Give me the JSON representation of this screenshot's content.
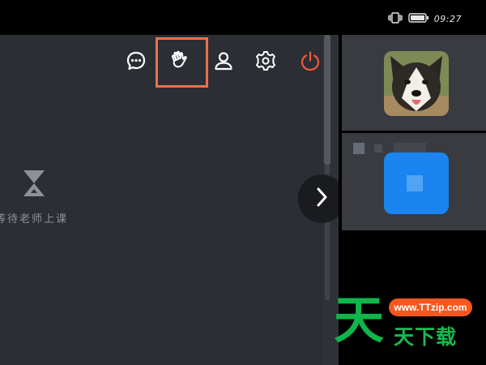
{
  "status_bar": {
    "time": "09:27",
    "icons": [
      "vibrate-icon",
      "battery-icon"
    ]
  },
  "toolbar": {
    "buttons": [
      {
        "name": "chat-icon",
        "highlighted": false
      },
      {
        "name": "raise-hand-icon",
        "highlighted": true
      },
      {
        "name": "user-icon",
        "highlighted": false
      },
      {
        "name": "gear-icon",
        "highlighted": false
      },
      {
        "name": "power-icon",
        "highlighted": false
      }
    ],
    "icon_color": "#ffffff",
    "power_color": "#f05a3a",
    "highlight_color": "#e8734e"
  },
  "classroom": {
    "waiting_icon": "hourglass-icon",
    "waiting_text": "等待老师上课"
  },
  "navigation": {
    "next_icon": "chevron-right-icon"
  },
  "participants": [
    {
      "avatar": "dog-photo"
    },
    {
      "avatar": "blue-default-avatar",
      "color": "#1a84f0"
    }
  ],
  "watermark": {
    "site": "www.TTzip.com",
    "big_char": "天",
    "text": "天下载",
    "green": "#0fb64b",
    "orange": "#f6571f"
  }
}
